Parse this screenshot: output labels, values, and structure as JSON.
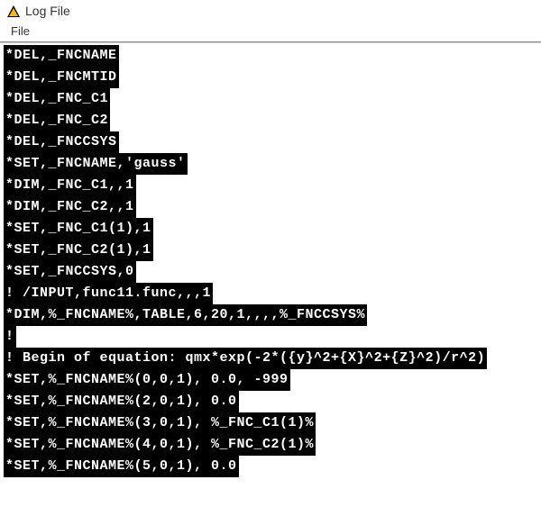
{
  "window": {
    "title": "Log File"
  },
  "menu": {
    "file": "File"
  },
  "log": {
    "lines": [
      "*DEL,_FNCNAME",
      "*DEL,_FNCMTID",
      "*DEL,_FNC_C1",
      "*DEL,_FNC_C2",
      "*DEL,_FNCCSYS",
      "*SET,_FNCNAME,'gauss'",
      "*DIM,_FNC_C1,,1",
      "*DIM,_FNC_C2,,1",
      "*SET,_FNC_C1(1),1",
      "*SET,_FNC_C2(1),1",
      "*SET,_FNCCSYS,0",
      "! /INPUT,func11.func,,,1",
      "*DIM,%_FNCNAME%,TABLE,6,20,1,,,,%_FNCCSYS%",
      "!",
      "! Begin of equation: qmx*exp(-2*({y}^2+{X}^2+{Z}^2)/r^2)",
      "*SET,%_FNCNAME%(0,0,1), 0.0, -999",
      "*SET,%_FNCNAME%(2,0,1), 0.0",
      "*SET,%_FNCNAME%(3,0,1), %_FNC_C1(1)%",
      "*SET,%_FNCNAME%(4,0,1), %_FNC_C2(1)%",
      "*SET,%_FNCNAME%(5,0,1), 0.0"
    ]
  }
}
